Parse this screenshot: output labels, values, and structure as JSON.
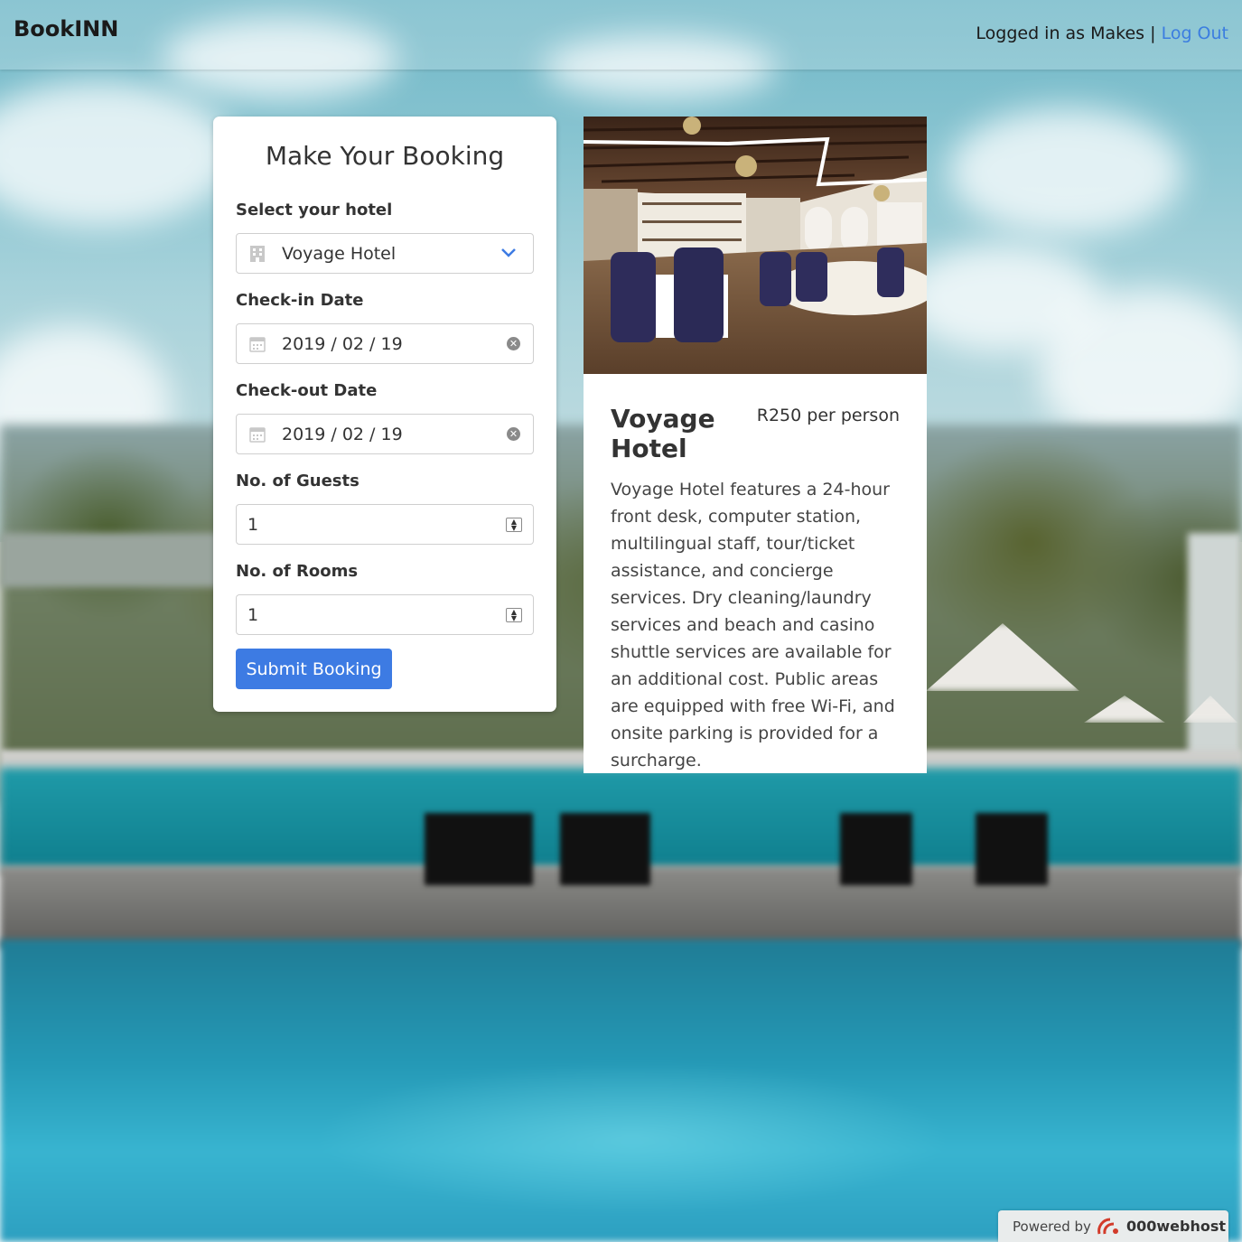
{
  "navbar": {
    "brand": "BookINN",
    "user_text": "Logged in as Makes |",
    "logout_label": "Log Out"
  },
  "booking_form": {
    "title": "Make Your Booking",
    "hotel_label": "Select your hotel",
    "hotel_value": "Voyage Hotel",
    "checkin_label": "Check-in Date",
    "checkin_value": "2019 / 02 / 19",
    "checkout_label": "Check-out Date",
    "checkout_value": "2019 / 02 / 19",
    "guests_label": "No. of Guests",
    "guests_value": "1",
    "rooms_label": "No. of Rooms",
    "rooms_value": "1",
    "submit_label": "Submit Booking"
  },
  "hotel_card": {
    "name": "Voyage Hotel",
    "price": "R250 per person",
    "description": "Voyage Hotel features a 24-hour front desk, computer station, multilingual staff, tour/ticket assistance, and concierge services. Dry cleaning/laundry services and beach and casino shuttle services are available for an additional cost. Public areas are equipped with free Wi-Fi, and onsite parking is provided for a surcharge."
  },
  "footer": {
    "powered_by": "Powered by",
    "host_name": "000webhost"
  },
  "colors": {
    "accent": "#3d7be3",
    "link": "#3b7de0",
    "card_bg": "#ffffff"
  },
  "icons": {
    "hotel_select": "building-icon",
    "dropdown": "chevron-down-icon",
    "date": "calendar-icon",
    "clear": "clear-icon",
    "spinner": "spinner-icon",
    "host_logo": "host-logo-icon"
  }
}
